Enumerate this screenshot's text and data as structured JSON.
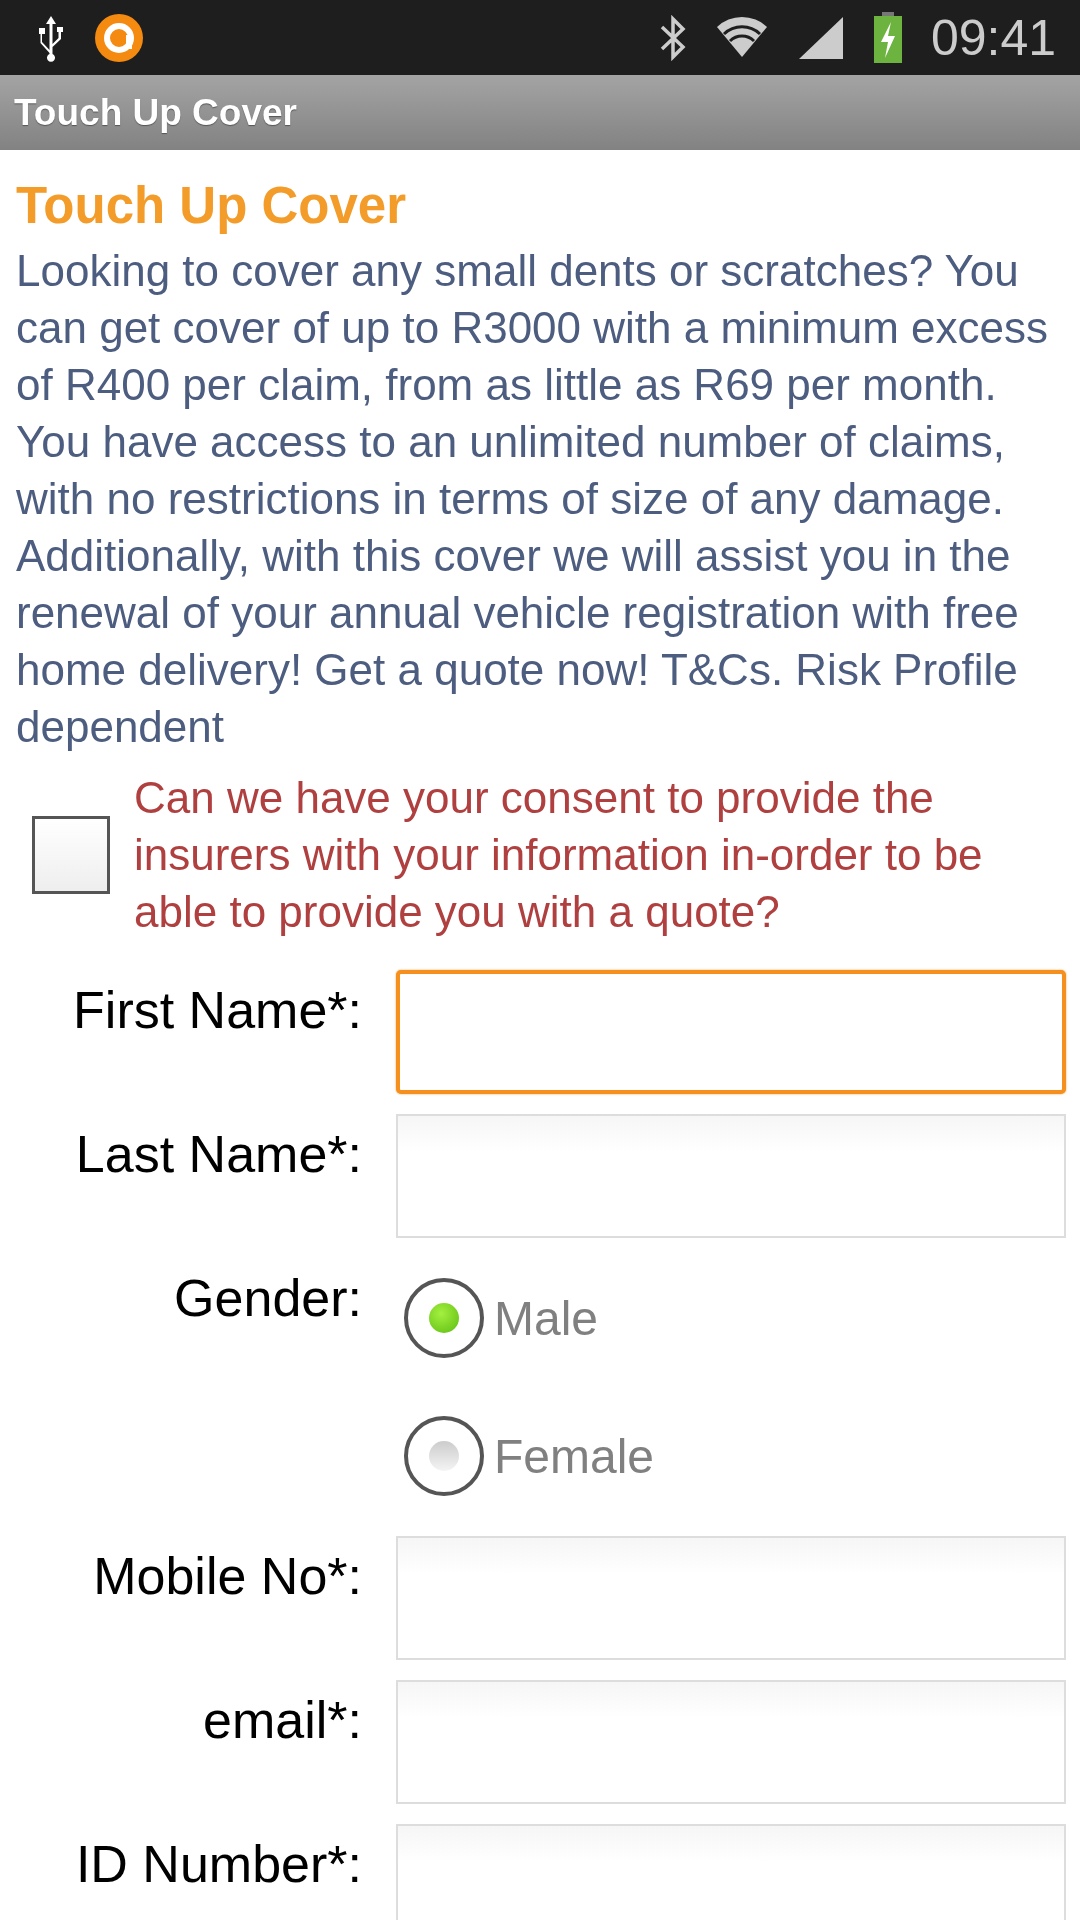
{
  "status_bar": {
    "time": "09:41"
  },
  "app_bar": {
    "title": "Touch Up Cover"
  },
  "heading": "Touch Up Cover",
  "description": "Looking to cover any small dents or scratches? You can get cover of up to R3000 with a minimum excess of R400 per claim, from as little as R69 per month. You have access to an unlimited number of claims, with no restrictions in terms of size of any damage. Additionally, with this cover we will assist you in the renewal of your annual vehicle registration with free home delivery! Get a quote now! T&Cs. Risk Profile dependent",
  "consent": {
    "label": "Can we have your consent to provide the insurers with your information in-order to be able to provide you with a quote?",
    "checked": false
  },
  "form": [
    {
      "kind": "text",
      "label": "First Name*:",
      "focused": true
    },
    {
      "kind": "text",
      "label": "Last Name*:",
      "focused": false
    },
    {
      "kind": "radio",
      "label": "Gender:",
      "options": [
        {
          "label": "Male",
          "selected": true
        },
        {
          "label": "Female",
          "selected": false
        }
      ]
    },
    {
      "kind": "text",
      "label": "Mobile No*:",
      "focused": false
    },
    {
      "kind": "text",
      "label": "email*:",
      "focused": false
    },
    {
      "kind": "text",
      "label": "ID Number*:",
      "focused": false
    }
  ]
}
